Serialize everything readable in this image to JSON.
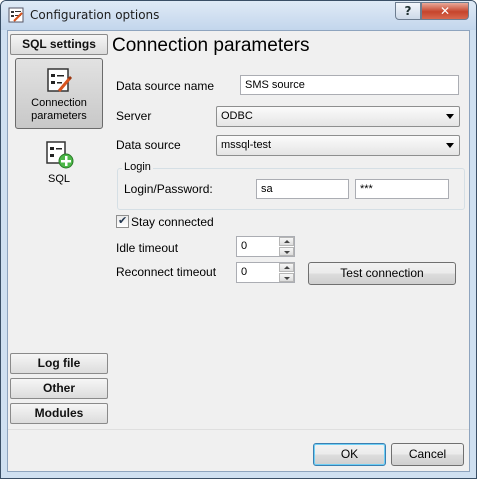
{
  "window": {
    "title": "Configuration options",
    "help_label": "?",
    "close_label": "✕"
  },
  "sidebar": {
    "top_button": "SQL settings",
    "items": [
      {
        "label_line1": "Connection",
        "label_line2": "parameters",
        "icon": "connection-edit-icon"
      },
      {
        "label": "SQL",
        "icon": "sql-add-icon"
      }
    ],
    "bottom_buttons": [
      "Log file",
      "Other",
      "Modules"
    ]
  },
  "main": {
    "heading": "Connection parameters",
    "data_source_name_label": "Data source name",
    "data_source_name_value": "SMS source",
    "server_label": "Server",
    "server_value": "ODBC",
    "data_source_label": "Data source",
    "data_source_value": "mssql-test",
    "login_group_title": "Login",
    "login_password_label": "Login/Password:",
    "login_value": "sa",
    "password_value": "***",
    "stay_connected_label": "Stay connected",
    "stay_connected_checked": true,
    "idle_timeout_label": "Idle timeout",
    "idle_timeout_value": "0",
    "reconnect_timeout_label": "Reconnect timeout",
    "reconnect_timeout_value": "0",
    "test_connection_label": "Test connection"
  },
  "footer": {
    "ok_label": "OK",
    "cancel_label": "Cancel"
  },
  "colors": {
    "accent": "#3c7fb1",
    "close_red": "#c6442c"
  }
}
